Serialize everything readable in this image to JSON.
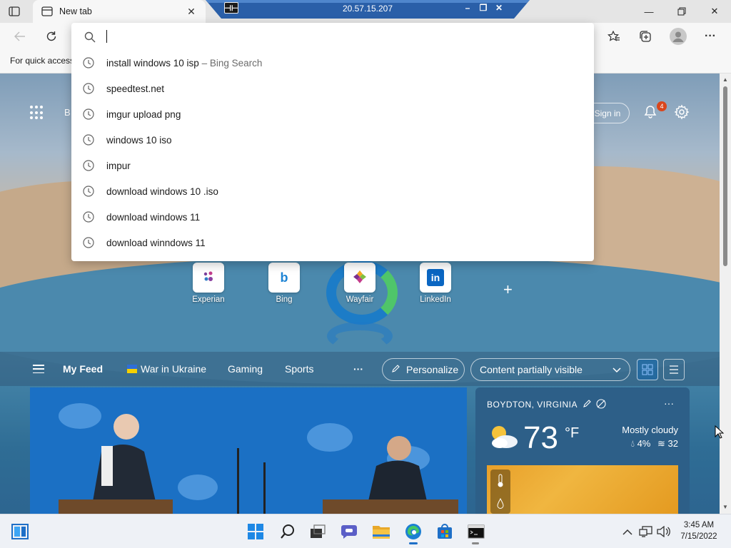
{
  "browser": {
    "tab_title": "New tab",
    "address_value": "",
    "favorites_bar_text": "For quick access"
  },
  "rdp": {
    "host": "20.57.15.207"
  },
  "header": {
    "partial_text": "B",
    "signin_label": "Sign in",
    "notification_count": "4"
  },
  "suggestions": [
    {
      "text": "install windows 10 isp",
      "sub": " – Bing Search"
    },
    {
      "text": "speedtest.net",
      "sub": ""
    },
    {
      "text": "imgur upload png",
      "sub": ""
    },
    {
      "text": "windows 10 iso",
      "sub": ""
    },
    {
      "text": "impur",
      "sub": ""
    },
    {
      "text": "download windows 10 .iso",
      "sub": ""
    },
    {
      "text": "download windows 11",
      "sub": ""
    },
    {
      "text": "download winndows 11",
      "sub": ""
    }
  ],
  "quick_links": [
    {
      "label": "Experian",
      "icon": "experian-icon",
      "color": "#7a3f9b"
    },
    {
      "label": "Bing",
      "icon": "bing-icon",
      "color": "#1d83d4"
    },
    {
      "label": "Wayfair",
      "icon": "wayfair-icon",
      "color": "#7b2f8e"
    },
    {
      "label": "LinkedIn",
      "icon": "linkedin-icon",
      "color": "#0a66c2"
    }
  ],
  "feed_nav": {
    "my_feed": "My Feed",
    "war_in_ukraine": "War in Ukraine",
    "gaming": "Gaming",
    "sports": "Sports",
    "more": "···",
    "personalize": "Personalize",
    "content_visibility": "Content partially visible"
  },
  "weather": {
    "location": "BOYDTON, VIRGINIA",
    "temperature": "73",
    "unit": "°F",
    "condition": "Mostly cloudy",
    "precipitation": "4%",
    "wind": "32",
    "more": "···"
  },
  "taskbar": {
    "time": "3:45 AM",
    "date": "7/15/2022"
  },
  "colors": {
    "accent": "#0067c0",
    "rdp_bar": "#2a5fa8",
    "notification_badge": "#d9461c"
  }
}
